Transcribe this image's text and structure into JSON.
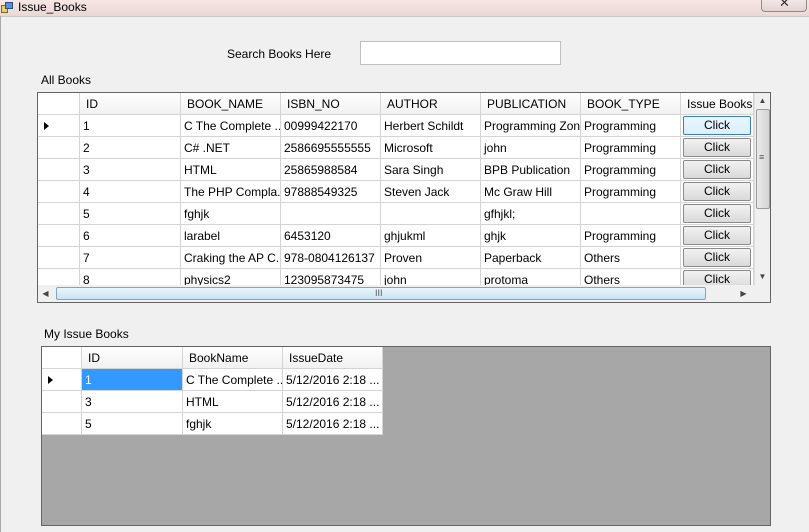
{
  "window": {
    "title": "Issue_Books",
    "close_label": "✕"
  },
  "search": {
    "label": "Search Books Here",
    "value": ""
  },
  "all_books": {
    "label": "All Books",
    "columns": [
      "ID",
      "BOOK_NAME",
      "ISBN_NO",
      "AUTHOR",
      "PUBLICATION",
      "BOOK_TYPE",
      "Issue Books"
    ],
    "rows": [
      {
        "id": "1",
        "name": "C The Complete ...",
        "isbn": "00999422170",
        "author": "Herbert Schildt",
        "publication": "Programming Zone",
        "type": "Programming",
        "action": "Click"
      },
      {
        "id": "2",
        "name": "C# .NET",
        "isbn": "2586695555555",
        "author": "Microsoft",
        "publication": "john",
        "type": "Programming",
        "action": "Click"
      },
      {
        "id": "3",
        "name": "HTML",
        "isbn": "25865988584",
        "author": "Sara Singh",
        "publication": "BPB Publication",
        "type": "Programming",
        "action": "Click"
      },
      {
        "id": "4",
        "name": "The PHP Compla...",
        "isbn": "97888549325",
        "author": "Steven Jack",
        "publication": "Mc Graw Hill",
        "type": "Programming",
        "action": "Click"
      },
      {
        "id": "5",
        "name": "fghjk",
        "isbn": "",
        "author": "",
        "publication": "gfhjkl;",
        "type": "",
        "action": "Click"
      },
      {
        "id": "6",
        "name": "larabel",
        "isbn": "6453120",
        "author": "ghjukml",
        "publication": "ghjk",
        "type": "Programming",
        "action": "Click"
      },
      {
        "id": "7",
        "name": "Craking the AP C...",
        "isbn": "978-0804126137",
        "author": "Proven",
        "publication": "Paperback",
        "type": "Others",
        "action": "Click"
      },
      {
        "id": "8",
        "name": "physics2",
        "isbn": "123095873475",
        "author": "john",
        "publication": "protoma",
        "type": "Others",
        "action": "Click"
      }
    ],
    "hscroll_grip": "III"
  },
  "my_issue_books": {
    "label": "My Issue Books",
    "columns": [
      "ID",
      "BookName",
      "IssueDate"
    ],
    "rows": [
      {
        "id": "1",
        "name": "C The Complete ...",
        "date": "5/12/2016 2:18 ..."
      },
      {
        "id": "3",
        "name": "HTML",
        "date": "5/12/2016 2:18 ..."
      },
      {
        "id": "5",
        "name": "fghjk",
        "date": "5/12/2016 2:18 ..."
      }
    ]
  },
  "icons": {
    "app": "app-window-icon",
    "close": "close-icon",
    "row_pointer": "row-pointer-icon"
  },
  "colors": {
    "selection": "#3399ff",
    "grid_background": "#a7a7a7",
    "titlebar": "#f3e2e0"
  }
}
